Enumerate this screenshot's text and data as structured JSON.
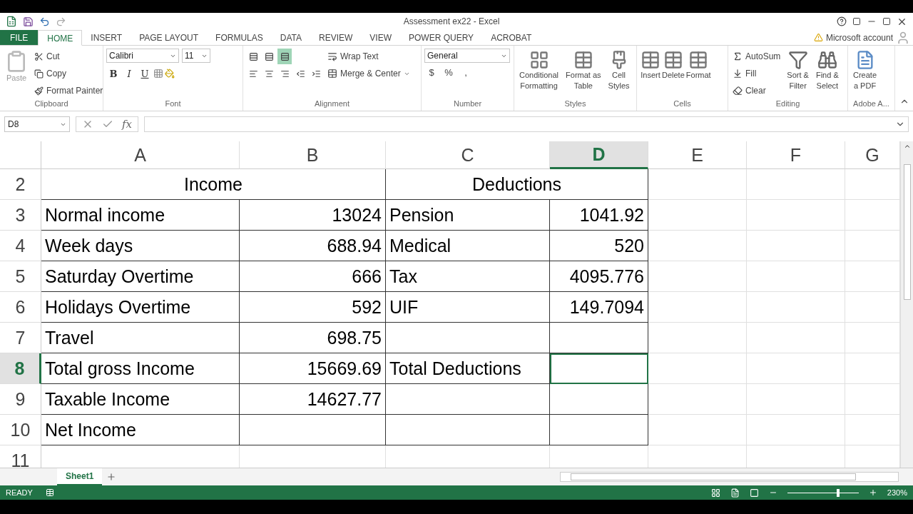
{
  "title": "Assessment ex22 - Excel",
  "tabs": [
    {
      "label": "FILE",
      "kind": "file",
      "selected": false
    },
    {
      "label": "HOME",
      "kind": "tab",
      "selected": true
    },
    {
      "label": "INSERT",
      "kind": "tab",
      "selected": false
    },
    {
      "label": "PAGE LAYOUT",
      "kind": "tab",
      "selected": false
    },
    {
      "label": "FORMULAS",
      "kind": "tab",
      "selected": false
    },
    {
      "label": "DATA",
      "kind": "tab",
      "selected": false
    },
    {
      "label": "REVIEW",
      "kind": "tab",
      "selected": false
    },
    {
      "label": "VIEW",
      "kind": "tab",
      "selected": false
    },
    {
      "label": "POWER QUERY",
      "kind": "tab",
      "selected": false
    },
    {
      "label": "ACROBAT",
      "kind": "tab",
      "selected": false
    }
  ],
  "account": "Microsoft account",
  "clipboard": {
    "title": "Clipboard",
    "paste": "Paste",
    "items": [
      "Cut",
      "Copy",
      "Format Painter"
    ]
  },
  "font": {
    "title": "Font",
    "family": "Calibri",
    "size": "11",
    "styles": [
      "B",
      "I",
      "U"
    ]
  },
  "alignment": {
    "title": "Alignment",
    "wrap": "Wrap Text",
    "merge": "Merge & Center",
    "vertical": [
      {
        "selected": false
      },
      {
        "selected": false
      },
      {
        "selected": true
      }
    ]
  },
  "number": {
    "title": "Number",
    "format": "General",
    "symbols": [
      "$",
      "%",
      ","
    ]
  },
  "styles": {
    "title": "Styles",
    "buttons": [
      {
        "lines": [
          "Conditional",
          "Formatting"
        ]
      },
      {
        "lines": [
          "Format as",
          "Table"
        ]
      },
      {
        "lines": [
          "Cell",
          "Styles"
        ]
      }
    ]
  },
  "cells": {
    "title": "Cells",
    "buttons": [
      "Insert",
      "Delete",
      "Format"
    ]
  },
  "editing": {
    "title": "Editing",
    "items": [
      "AutoSum",
      "Fill",
      "Clear"
    ],
    "buttons": [
      {
        "lines": [
          "Sort &",
          "Filter"
        ]
      },
      {
        "lines": [
          "Find &",
          "Select"
        ]
      }
    ]
  },
  "adobe": {
    "title": "Adobe A...",
    "button": {
      "lines": [
        "Create",
        "a PDF"
      ]
    }
  },
  "name_box": "D8",
  "function_symbol": "fx",
  "columns": [
    {
      "label": "A",
      "selected": false
    },
    {
      "label": "B",
      "selected": false
    },
    {
      "label": "C",
      "selected": false
    },
    {
      "label": "D",
      "selected": true
    },
    {
      "label": "E",
      "selected": false
    },
    {
      "label": "F",
      "selected": false
    },
    {
      "label": "G",
      "selected": false
    }
  ],
  "rows": [
    {
      "header": "2",
      "selected": false,
      "cells": [
        {
          "kind": "heading",
          "text": "Income",
          "selected": false
        },
        {
          "kind": "heading",
          "text": "Deductions",
          "selected": false
        }
      ]
    },
    {
      "header": "3",
      "selected": false,
      "cells": [
        {
          "kind": "label",
          "text": "Normal income",
          "selected": false
        },
        {
          "kind": "number",
          "text": "13024",
          "selected": false
        },
        {
          "kind": "label",
          "text": "Pension",
          "selected": false
        },
        {
          "kind": "number",
          "text": "1041.92",
          "selected": false
        }
      ]
    },
    {
      "header": "4",
      "selected": false,
      "cells": [
        {
          "kind": "label",
          "text": "Week days",
          "selected": false
        },
        {
          "kind": "number",
          "text": "688.94",
          "selected": false
        },
        {
          "kind": "label",
          "text": "Medical",
          "selected": false
        },
        {
          "kind": "number",
          "text": "520",
          "selected": false
        }
      ]
    },
    {
      "header": "5",
      "selected": false,
      "cells": [
        {
          "kind": "label",
          "text": "Saturday Overtime",
          "selected": false
        },
        {
          "kind": "number",
          "text": "666",
          "selected": false
        },
        {
          "kind": "label",
          "text": "Tax",
          "selected": false
        },
        {
          "kind": "number",
          "text": "4095.776",
          "selected": false
        }
      ]
    },
    {
      "header": "6",
      "selected": false,
      "cells": [
        {
          "kind": "label",
          "text": "Holidays Overtime",
          "selected": false
        },
        {
          "kind": "number",
          "text": "592",
          "selected": false
        },
        {
          "kind": "label",
          "text": "UIF",
          "selected": false
        },
        {
          "kind": "number",
          "text": "149.7094",
          "selected": false
        }
      ]
    },
    {
      "header": "7",
      "selected": false,
      "cells": [
        {
          "kind": "label",
          "text": "Travel",
          "selected": false
        },
        {
          "kind": "number",
          "text": "698.75",
          "selected": false
        },
        {
          "kind": "empty",
          "selected": false
        },
        {
          "kind": "empty",
          "selected": false
        }
      ]
    },
    {
      "header": "8",
      "selected": true,
      "cells": [
        {
          "kind": "label",
          "text": "Total gross Income",
          "selected": false
        },
        {
          "kind": "number",
          "text": "15669.69",
          "selected": false
        },
        {
          "kind": "label",
          "text": "Total Deductions",
          "selected": false
        },
        {
          "kind": "empty",
          "selected": true
        }
      ]
    },
    {
      "header": "9",
      "selected": false,
      "cells": [
        {
          "kind": "label",
          "text": "Taxable Income",
          "selected": false
        },
        {
          "kind": "number",
          "text": "14627.77",
          "selected": false
        },
        {
          "kind": "empty",
          "selected": false
        },
        {
          "kind": "empty",
          "selected": false
        }
      ]
    },
    {
      "header": "10",
      "selected": false,
      "cells": [
        {
          "kind": "label",
          "text": "Net Income",
          "selected": false
        },
        {
          "kind": "empty",
          "selected": false
        },
        {
          "kind": "empty",
          "selected": false
        },
        {
          "kind": "empty",
          "selected": false
        }
      ]
    },
    {
      "header": "11",
      "selected": false
    }
  ],
  "sheets": [
    {
      "label": "Sheet1",
      "selected": true
    }
  ],
  "status": "READY",
  "zoom": "230%",
  "zoom_slider": {
    "level": 0.72
  }
}
